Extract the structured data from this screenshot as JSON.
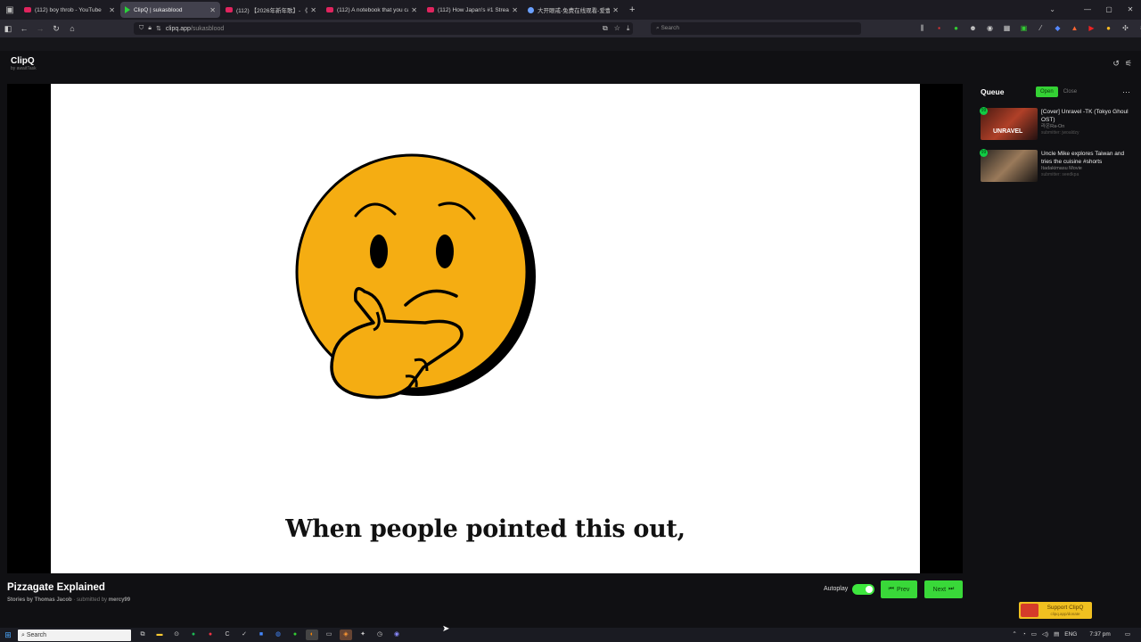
{
  "browser": {
    "tabs": [
      {
        "title": "(112) boy throb - YouTube",
        "icon": "youtube-icon",
        "active": false
      },
      {
        "title": "ClipQ | sukasblood",
        "icon": "clipq-play-icon",
        "active": true
      },
      {
        "title": "(112) 【2026年新年歌】- 《仙",
        "icon": "youtube-icon",
        "active": false
      },
      {
        "title": "(112) A notebook that you can",
        "icon": "youtube-icon",
        "active": false
      },
      {
        "title": "(112) How Japan's #1 Streamer",
        "icon": "youtube-icon",
        "active": false
      },
      {
        "title": "大开眼戒-免费在线观看-爱壹帆",
        "icon": "rocket-icon",
        "active": false
      }
    ],
    "url_host": "clipq.app",
    "url_path": "/sukasblood",
    "search_placeholder": "Search"
  },
  "app": {
    "name": "ClipQ",
    "byline": "by awaitTask"
  },
  "player": {
    "caption": "When people pointed this out,",
    "title": "Pizzagate Explained",
    "channel": "Stories by Thomas Jacob",
    "submitted_prefix": "· submitted by",
    "submitter": "mercy99",
    "autoplay_label": "Autoplay",
    "autoplay_on": true,
    "prev_label": "Prev",
    "next_label": "Next"
  },
  "queue": {
    "title": "Queue",
    "open_label": "Open",
    "close_label": "Close",
    "items": [
      {
        "badge": "99",
        "thumb_text": "UNRAVEL",
        "title": "[Cover] Unravel -TK (Tokyo Ghoul OST)",
        "channel": "라온Ra-On",
        "submitter": "submitter: jwoaldzy"
      },
      {
        "badge": "99",
        "thumb_text": "",
        "title": "Uncle Mike explores Taiwan and tries the cuisine #shorts",
        "channel": "Itadakimasu Movie",
        "submitter": "submitter: seedkpa"
      }
    ]
  },
  "support": {
    "label": "Support ClipQ",
    "url": "clipq.app/donate"
  },
  "taskbar": {
    "search_placeholder": "Search",
    "lang": "ENG",
    "time": "7:37 pm"
  },
  "colors": {
    "accent_green": "#39d839",
    "emoji_yellow": "#f5ad12"
  }
}
